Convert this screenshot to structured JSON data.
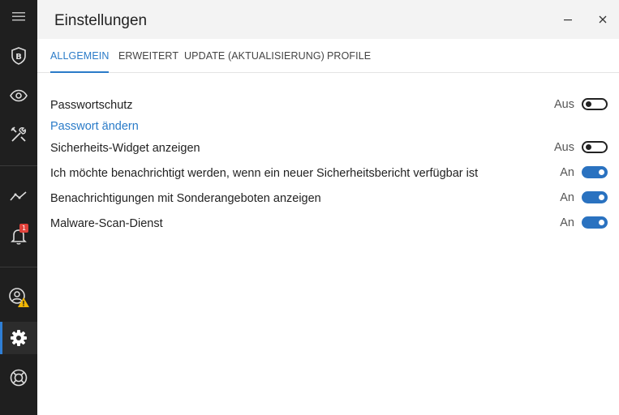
{
  "window": {
    "title": "Einstellungen"
  },
  "sidebar": {
    "items": [
      {
        "icon": "menu-icon"
      },
      {
        "icon": "shield-icon",
        "letter": "B"
      },
      {
        "icon": "eye-icon"
      },
      {
        "icon": "tools-icon"
      },
      {
        "icon": "activity-icon"
      },
      {
        "icon": "bell-icon",
        "badge": "1"
      },
      {
        "icon": "account-warning-icon"
      },
      {
        "icon": "gear-icon",
        "active": true
      },
      {
        "icon": "lifebuoy-icon"
      }
    ]
  },
  "tabs": [
    {
      "label": "ALLGEMEIN",
      "active": true
    },
    {
      "label": "ERWEITERT"
    },
    {
      "label": "UPDATE (AKTUALISIERUNG)"
    },
    {
      "label": "PROFILE"
    }
  ],
  "settings": {
    "password": {
      "label": "Passwortschutz",
      "state": "Aus",
      "on": false
    },
    "change_password_link": "Passwort ändern",
    "widget": {
      "label": "Sicherheits-Widget anzeigen",
      "state": "Aus",
      "on": false
    },
    "report_notify": {
      "label": "Ich möchte benachrichtigt werden, wenn ein neuer Sicherheitsbericht verfügbar ist",
      "state": "An",
      "on": true
    },
    "offers": {
      "label": "Benachrichtigungen mit Sonderangeboten anzeigen",
      "state": "An",
      "on": true
    },
    "malware": {
      "label": "Malware-Scan-Dienst",
      "state": "An",
      "on": true
    }
  },
  "colors": {
    "accent": "#2a7bc8",
    "sidebar_bg": "#1f1f1f",
    "badge": "#e0413a",
    "warning": "#f2b705"
  }
}
